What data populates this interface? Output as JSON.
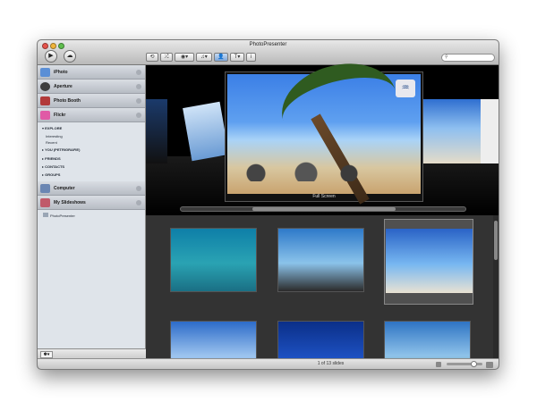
{
  "window": {
    "title": "PhotoPresenter"
  },
  "toolbar": {
    "play_icon": "▶",
    "cloud_icon": "☁",
    "buttons": [
      {
        "name": "loop-icon",
        "glyph": "⟲"
      },
      {
        "name": "shuffle-icon",
        "glyph": "⤮"
      },
      {
        "name": "effects-icon",
        "glyph": "◉▾"
      },
      {
        "name": "music-icon",
        "glyph": "♫▾"
      },
      {
        "name": "person-icon",
        "glyph": "👤"
      },
      {
        "name": "text-icon",
        "glyph": "T▾"
      },
      {
        "name": "info-icon",
        "glyph": "i"
      }
    ],
    "search_glyph": "⚲"
  },
  "sidebar": {
    "sources": [
      {
        "label": "iPhoto",
        "color": "#5b8fd6"
      },
      {
        "label": "Aperture",
        "color": "#3d3d3d"
      },
      {
        "label": "Photo Booth",
        "color": "#b23a3a"
      },
      {
        "label": "Flickr",
        "color": "#e05aa6"
      }
    ],
    "flickr_items": [
      {
        "label": "EXPLORE",
        "marker": "▾"
      },
      {
        "label": "Interesting",
        "marker": ""
      },
      {
        "label": "Recent",
        "marker": ""
      },
      {
        "label": "YOU (PETRIGRAFIE)",
        "marker": "▸"
      },
      {
        "label": "FRIENDS",
        "marker": "▸"
      },
      {
        "label": "CONTACTS",
        "marker": "▸"
      },
      {
        "label": "GROUPS",
        "marker": "▸"
      }
    ],
    "lower_sources": [
      {
        "label": "Computer",
        "color": "#6a86b3"
      },
      {
        "label": "My Slideshows",
        "color": "#c05a6a"
      }
    ],
    "slideshows": [
      {
        "label": "PhotoPresenter"
      }
    ],
    "footer_add": "✽▾"
  },
  "preview": {
    "label": "Full Screen",
    "badge": "♒"
  },
  "grid": {
    "thumbnails": [
      {
        "name": "thumb-underwater-turtles",
        "top": "#0e7fa8",
        "mid": "#2aa3b3",
        "bottom": "#1a6f84",
        "selected": false
      },
      {
        "name": "thumb-palm-rocks-beach",
        "top": "#2e79c9",
        "mid": "#8bc3ea",
        "bottom": "#2b2b2b",
        "selected": false
      },
      {
        "name": "thumb-beach-hut",
        "top": "#2a63c6",
        "mid": "#77b7f1",
        "bottom": "#e9e2d3",
        "selected": true
      },
      {
        "name": "thumb-clouds-sky",
        "top": "#2d6cc9",
        "mid": "#9dc4ef",
        "bottom": "#5aa5e8",
        "selected": false
      },
      {
        "name": "thumb-deep-blue-sea",
        "top": "#0b2f88",
        "mid": "#1c4fbf",
        "bottom": "#2b7bd8",
        "selected": false
      },
      {
        "name": "thumb-palm-sky",
        "top": "#2f74c3",
        "mid": "#8fc3ea",
        "bottom": "#3a6b2a",
        "selected": false
      }
    ]
  },
  "status": {
    "text": "1 of 13 slides"
  }
}
